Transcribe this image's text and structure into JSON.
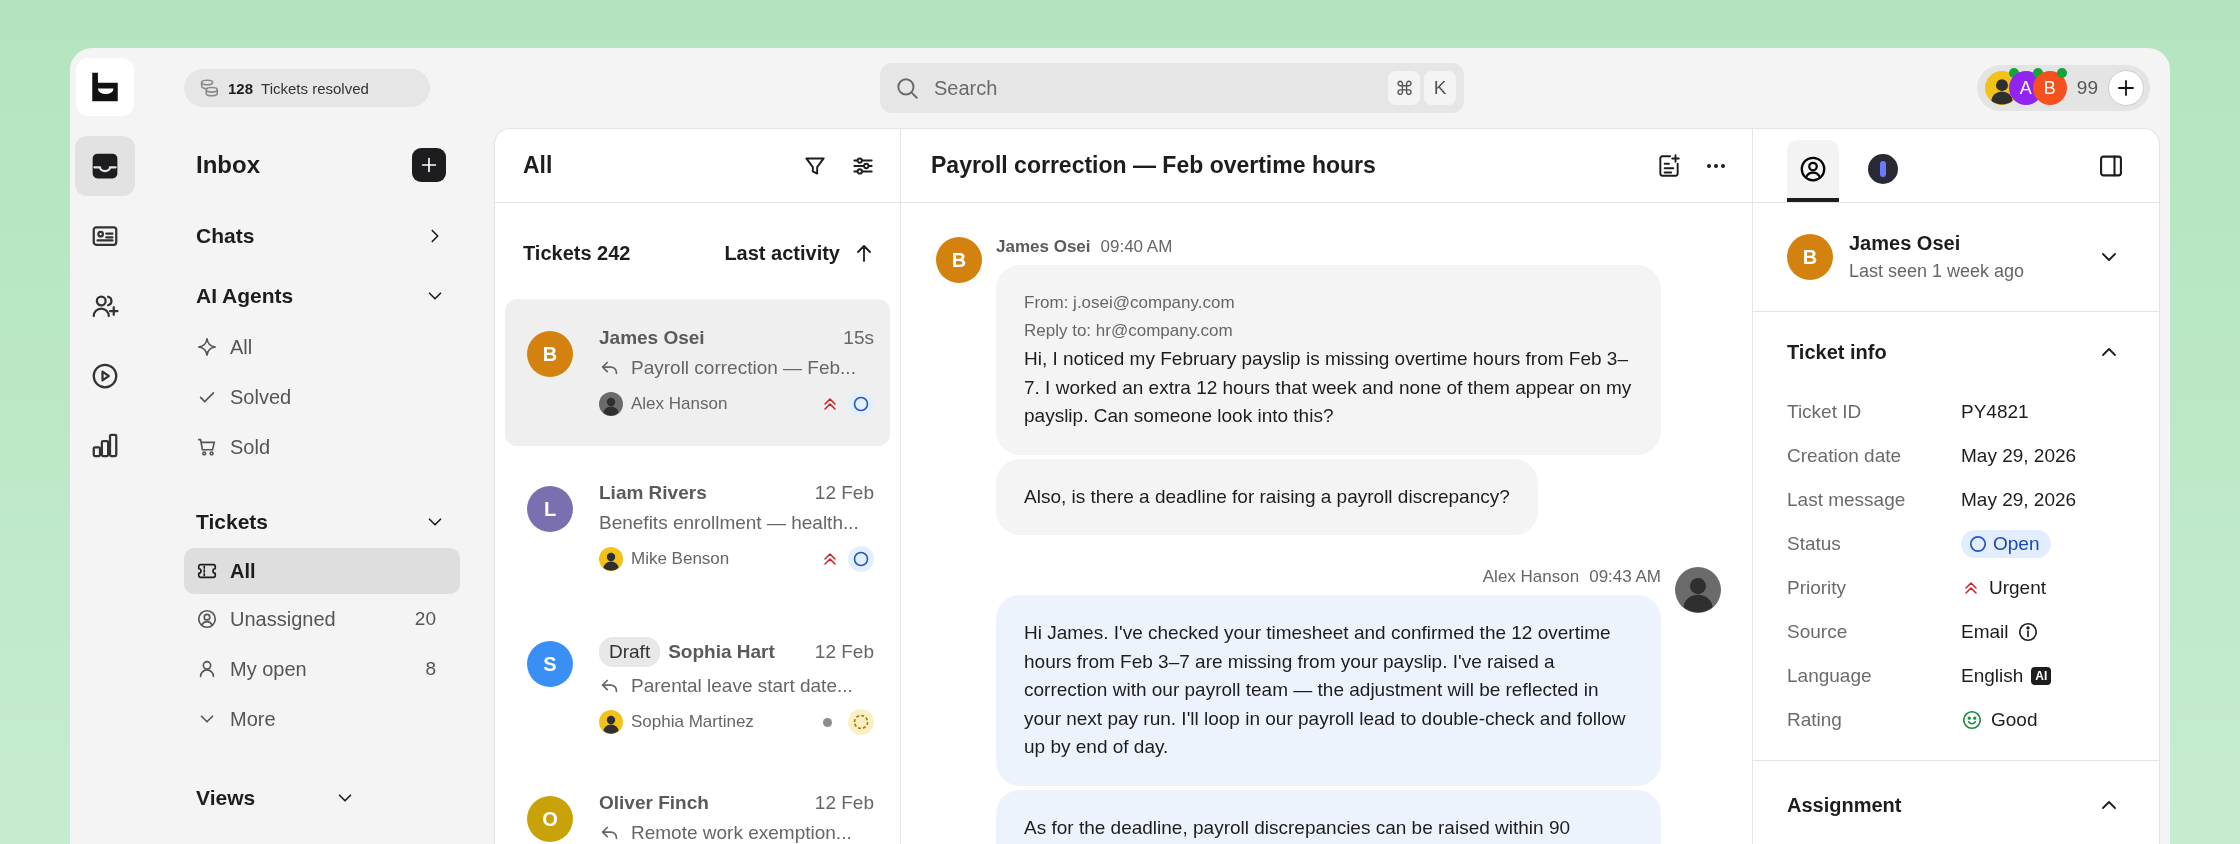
{
  "rail": {
    "items": [
      {
        "kind": "inbox",
        "selected": true
      },
      {
        "kind": "contacts",
        "selected": false
      },
      {
        "kind": "people",
        "selected": false
      },
      {
        "kind": "play",
        "selected": false
      },
      {
        "kind": "chart",
        "selected": false
      }
    ]
  },
  "top_bar": {
    "resolved": {
      "count": "128",
      "label": "Tickets resolved"
    },
    "search": {
      "placeholder": "Search",
      "shortcut": [
        "⌘",
        "K"
      ]
    },
    "presence": {
      "avatars": [
        {
          "kind": "photo",
          "color": "#f2c21b",
          "online": true
        },
        {
          "kind": "letter",
          "letter": "A",
          "color": "#9323ef",
          "online": true
        },
        {
          "kind": "letter",
          "letter": "B",
          "color": "#f4511e",
          "online": true
        }
      ],
      "count": "99"
    }
  },
  "sidebar": {
    "title": "Inbox",
    "sections": [
      {
        "title": "Chats",
        "expanded": false
      },
      {
        "title": "AI Agents",
        "expanded": true,
        "items": [
          {
            "kind": "sparkle",
            "label": "All",
            "selected": false
          },
          {
            "kind": "check",
            "label": "Solved",
            "selected": false
          },
          {
            "kind": "cart",
            "label": "Sold",
            "selected": false
          }
        ]
      },
      {
        "title": "Tickets",
        "expanded": true,
        "items": [
          {
            "kind": "ticket",
            "label": "All",
            "selected": true
          },
          {
            "kind": "user-circle",
            "label": "Unassigned",
            "count": "20",
            "selected": false
          },
          {
            "kind": "user",
            "label": "My open",
            "count": "8",
            "selected": false
          },
          {
            "kind": "more",
            "label": "More",
            "selected": false
          }
        ]
      },
      {
        "title": "Views",
        "expanded": true
      }
    ]
  },
  "ticket_list": {
    "title": "All",
    "count_label": "Tickets 242",
    "sort": "Last activity",
    "tickets": [
      {
        "letter": "B",
        "color": "#d4820f",
        "name": "James Osei",
        "time": "15s",
        "replied": true,
        "subject": "Payroll correction — Feb...",
        "assignee": {
          "name": "Alex Hanson",
          "color": "#6b6b6b"
        },
        "priority": {
          "kind": "urgent"
        },
        "status": {
          "kind": "open"
        },
        "selected": true
      },
      {
        "letter": "L",
        "color": "#7a70b0",
        "name": "Liam Rivers",
        "time": "12 Feb",
        "replied": false,
        "subject": "Benefits enrollment — health...",
        "assignee": {
          "name": "Mike Benson",
          "color": "#f2c21b"
        },
        "priority": {
          "kind": "urgent"
        },
        "status": {
          "kind": "open"
        },
        "selected": false
      },
      {
        "letter": "S",
        "color": "#3a8ff5",
        "badge": "Draft",
        "name": "Sophia Hart",
        "time": "12 Feb",
        "replied": true,
        "subject": "Parental leave start date...",
        "assignee": {
          "name": "Sophia Martinez",
          "color": "#f2c21b"
        },
        "priority": {
          "kind": "normal"
        },
        "status": {
          "kind": "pending"
        },
        "selected": false
      },
      {
        "letter": "O",
        "color": "#c9a108",
        "name": "Oliver Finch",
        "time": "12 Feb",
        "replied": true,
        "subject": "Remote work exemption...",
        "selected": false
      }
    ]
  },
  "conversation": {
    "title": "Payroll correction — Feb overtime hours",
    "messages": [
      {
        "kind": "incoming",
        "author": "James Osei",
        "time": "09:40 AM",
        "letter": "B",
        "color": "#d4820f",
        "bubbles": [
          {
            "meta": [
              "From: j.osei@company.com",
              "Reply to: hr@company.com"
            ],
            "text": "Hi, I noticed my February payslip is missing overtime hours from Feb 3–7. I worked an extra 12 hours that week and none of them appear on my payslip. Can someone look into this?"
          },
          {
            "text": "Also, is there a deadline for raising a payroll discrepancy?"
          }
        ]
      },
      {
        "kind": "outgoing",
        "author": "Alex Hanson",
        "time": "09:43 AM",
        "bubbles": [
          {
            "text": "Hi James. I've checked your timesheet and confirmed the 12 overtime hours from Feb 3–7 are missing from your payslip. I've raised a correction with our payroll team — the adjustment will be reflected in your next pay run. I'll loop in our payroll lead to double-check and follow up by end of day."
          },
          {
            "text": "As for the deadline, payroll discrepancies can be raised within 90"
          }
        ]
      }
    ]
  },
  "details": {
    "tabs": [
      {
        "kind": "profile",
        "selected": true
      },
      {
        "kind": "assistant",
        "selected": false
      }
    ],
    "contact": {
      "letter": "B",
      "color": "#d4820f",
      "name": "James Osei",
      "last_seen": "Last seen 1 week ago",
      "expanded": false
    },
    "ticket_info": {
      "title": "Ticket info",
      "expanded": true,
      "fields": [
        {
          "kind": "text",
          "label": "Ticket ID",
          "value": "PY4821"
        },
        {
          "kind": "text",
          "label": "Creation date",
          "value": "May 29, 2026"
        },
        {
          "kind": "text",
          "label": "Last message",
          "value": "May 29, 2026"
        },
        {
          "kind": "status",
          "label": "Status",
          "value": "Open"
        },
        {
          "kind": "priority",
          "label": "Priority",
          "value": "Urgent"
        },
        {
          "kind": "source",
          "label": "Source",
          "value": "Email"
        },
        {
          "kind": "language",
          "label": "Language",
          "value": "English",
          "badge": "AI"
        },
        {
          "kind": "rating",
          "label": "Rating",
          "value": "Good"
        }
      ]
    },
    "assignment": {
      "title": "Assignment",
      "expanded": true
    }
  }
}
